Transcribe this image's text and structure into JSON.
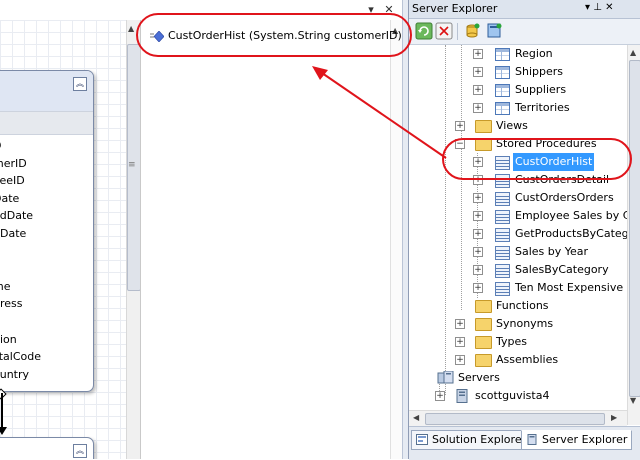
{
  "window_buttons": {
    "dropdown": "▾",
    "close": "✕"
  },
  "designer": {
    "table_columns": [
      "D",
      "merID",
      "yeeID",
      "Date",
      "edDate",
      "dDate",
      "a",
      "",
      "me",
      "dress",
      "y",
      "gion",
      "stalCode",
      "ountry"
    ],
    "method": "CustOrderHist (System.String customerID)"
  },
  "server_explorer": {
    "title": "Server Explorer",
    "pin_glyph": "▾ ⊥ ✕",
    "tree": [
      {
        "label": "Region",
        "icon": "table-icon"
      },
      {
        "label": "Shippers",
        "icon": "table-icon"
      },
      {
        "label": "Suppliers",
        "icon": "table-icon"
      },
      {
        "label": "Territories",
        "icon": "table-icon"
      },
      {
        "label": "Views",
        "icon": "folder-icon"
      },
      {
        "label": "Stored Procedures",
        "icon": "folder-icon"
      },
      {
        "label": "CustOrderHist",
        "icon": "stored-procedure-icon",
        "selected": true
      },
      {
        "label": "CustOrdersDetail",
        "icon": "stored-procedure-icon"
      },
      {
        "label": "CustOrdersOrders",
        "icon": "stored-procedure-icon"
      },
      {
        "label": "Employee Sales by C",
        "icon": "stored-procedure-icon"
      },
      {
        "label": "GetProductsByCateg",
        "icon": "stored-procedure-icon"
      },
      {
        "label": "Sales by Year",
        "icon": "stored-procedure-icon"
      },
      {
        "label": "SalesByCategory",
        "icon": "stored-procedure-icon"
      },
      {
        "label": "Ten Most Expensive",
        "icon": "stored-procedure-icon"
      },
      {
        "label": "Functions",
        "icon": "folder-icon"
      },
      {
        "label": "Synonyms",
        "icon": "folder-icon"
      },
      {
        "label": "Types",
        "icon": "folder-icon"
      },
      {
        "label": "Assemblies",
        "icon": "folder-icon"
      },
      {
        "label": "Servers",
        "icon": "servers-icon"
      },
      {
        "label": "scottguvista4",
        "icon": "server-icon"
      }
    ],
    "tabs": [
      {
        "label": "Solution Explorer",
        "active": false
      },
      {
        "label": "Server Explorer",
        "active": true
      }
    ]
  },
  "colors": {
    "highlight": "#e0141b",
    "selection": "#3399ff"
  }
}
